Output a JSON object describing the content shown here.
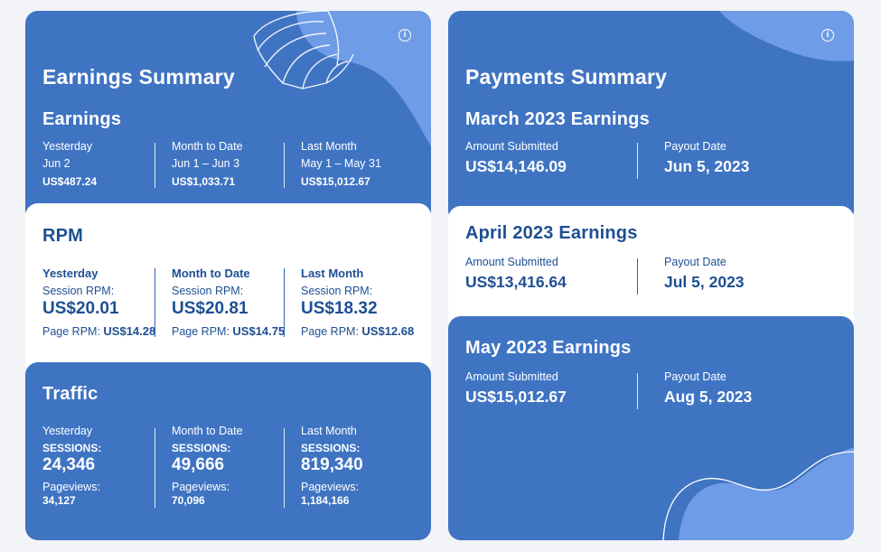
{
  "earnings": {
    "title": "Earnings Summary",
    "subtitle": "Earnings",
    "cols": [
      {
        "label": "Yesterday",
        "period": "Jun 2",
        "value": "US$487.24"
      },
      {
        "label": "Month to Date",
        "period": "Jun 1 – Jun 3",
        "value": "US$1,033.71"
      },
      {
        "label": "Last Month",
        "period": "May 1 – May 31",
        "value": "US$15,012.67"
      }
    ]
  },
  "rpm": {
    "title": "RPM",
    "cols": [
      {
        "heading": "Yesterday",
        "session_label": "Session RPM:",
        "session_value": "US$20.01",
        "page_label": "Page RPM:",
        "page_value": "US$14.28"
      },
      {
        "heading": "Month to Date",
        "session_label": "Session RPM:",
        "session_value": "US$20.81",
        "page_label": "Page RPM:",
        "page_value": "US$14.75"
      },
      {
        "heading": "Last Month",
        "session_label": "Session RPM:",
        "session_value": "US$18.32",
        "page_label": "Page RPM:",
        "page_value": "US$12.68"
      }
    ]
  },
  "traffic": {
    "title": "Traffic",
    "cols": [
      {
        "label": "Yesterday",
        "sessions_label": "SESSIONS:",
        "sessions_value": "24,346",
        "pageviews_label": "Pageviews:",
        "pageviews_value": "34,127"
      },
      {
        "label": "Month to Date",
        "sessions_label": "SESSIONS:",
        "sessions_value": "49,666",
        "pageviews_label": "Pageviews:",
        "pageviews_value": "70,096"
      },
      {
        "label": "Last Month",
        "sessions_label": "SESSIONS:",
        "sessions_value": "819,340",
        "pageviews_label": "Pageviews:",
        "pageviews_value": "1,184,166"
      }
    ]
  },
  "payments": {
    "title": "Payments Summary",
    "months": [
      {
        "title": "March 2023 Earnings",
        "amount_label": "Amount Submitted",
        "amount": "US$14,146.09",
        "payout_label": "Payout Date",
        "payout": "Jun 5, 2023"
      },
      {
        "title": "April 2023 Earnings",
        "amount_label": "Amount Submitted",
        "amount": "US$13,416.64",
        "payout_label": "Payout Date",
        "payout": "Jul 5, 2023"
      },
      {
        "title": "May 2023 Earnings",
        "amount_label": "Amount Submitted",
        "amount": "US$15,012.67",
        "payout_label": "Payout Date",
        "payout": "Aug 5, 2023"
      }
    ]
  },
  "icons": {
    "info": "i"
  },
  "colors": {
    "brand_blue": "#3f74c3",
    "light_blue": "#6e9ce6",
    "text_dark_blue": "#1d4f93"
  }
}
